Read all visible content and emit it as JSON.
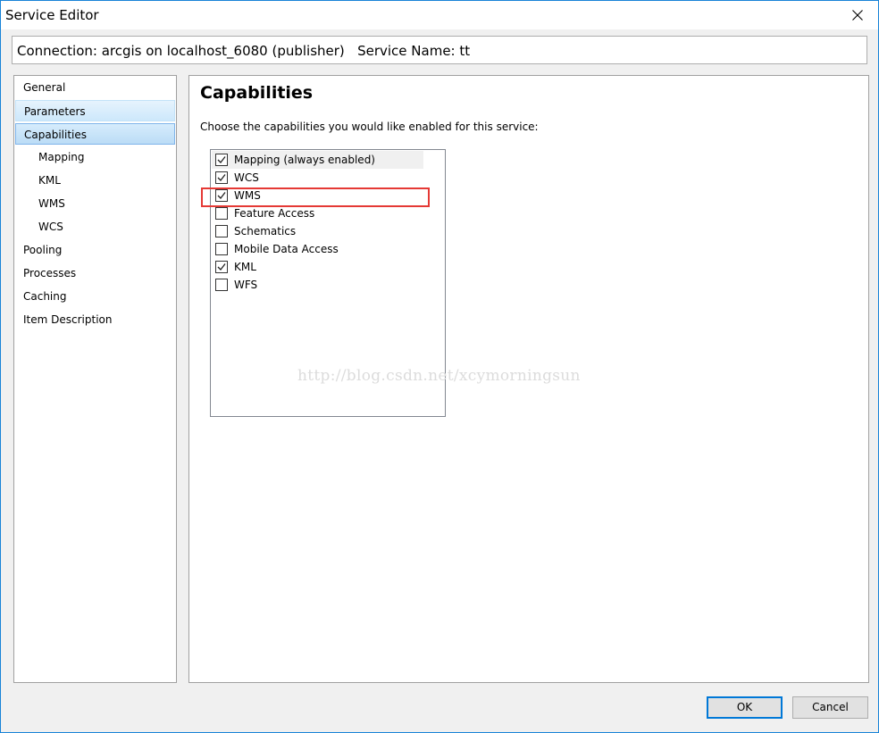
{
  "window": {
    "title": "Service Editor"
  },
  "connection": {
    "label": "Connection: arcgis on localhost_6080 (publisher)",
    "service_label": "Service Name: tt"
  },
  "nav": {
    "items": [
      {
        "label": "General",
        "indent": 0,
        "state": "none"
      },
      {
        "label": "Parameters",
        "indent": 0,
        "state": "hover"
      },
      {
        "label": "Capabilities",
        "indent": 0,
        "state": "selected"
      },
      {
        "label": "Mapping",
        "indent": 1,
        "state": "none"
      },
      {
        "label": "KML",
        "indent": 1,
        "state": "none"
      },
      {
        "label": "WMS",
        "indent": 1,
        "state": "none"
      },
      {
        "label": "WCS",
        "indent": 1,
        "state": "none"
      },
      {
        "label": "Pooling",
        "indent": 0,
        "state": "none"
      },
      {
        "label": "Processes",
        "indent": 0,
        "state": "none"
      },
      {
        "label": "Caching",
        "indent": 0,
        "state": "none"
      },
      {
        "label": "Item Description",
        "indent": 0,
        "state": "none"
      }
    ]
  },
  "capabilities": {
    "heading": "Capabilities",
    "description": "Choose the capabilities you would like enabled for this service:",
    "items": [
      {
        "label": "Mapping (always enabled)",
        "checked": true
      },
      {
        "label": "WCS",
        "checked": true
      },
      {
        "label": "WMS",
        "checked": true
      },
      {
        "label": "Feature Access",
        "checked": false
      },
      {
        "label": "Schematics",
        "checked": false
      },
      {
        "label": "Mobile Data Access",
        "checked": false
      },
      {
        "label": "KML",
        "checked": true
      },
      {
        "label": "WFS",
        "checked": false
      }
    ]
  },
  "watermark": "http://blog.csdn.net/xcymorningsun",
  "buttons": {
    "ok": "OK",
    "cancel": "Cancel"
  },
  "colors": {
    "accent": "#0078d7",
    "annotation": "#e53935",
    "selection": "#cde8fb"
  }
}
